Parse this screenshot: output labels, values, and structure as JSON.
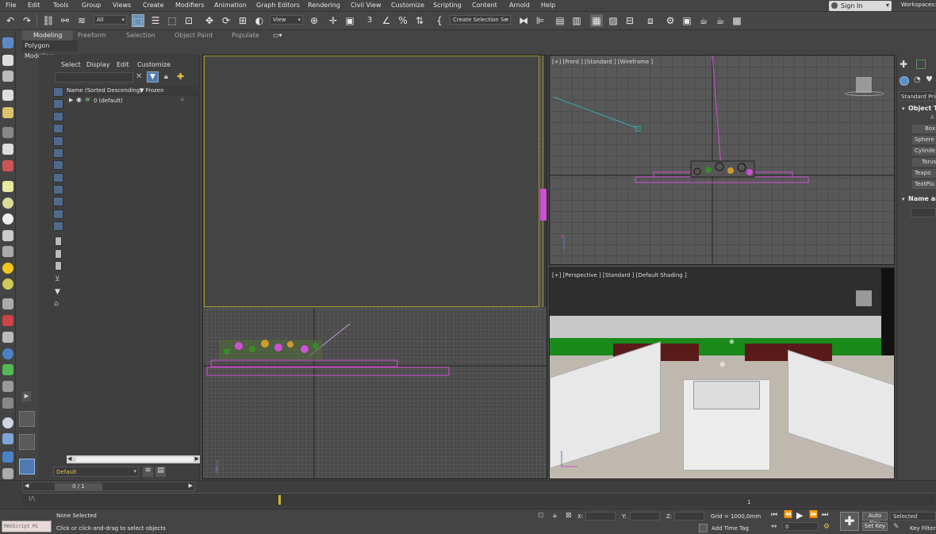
{
  "menu": [
    "File",
    "Edit",
    "Tools",
    "Group",
    "Views",
    "Create",
    "Modifiers",
    "Animation",
    "Graph Editors",
    "Rendering",
    "Civil View",
    "Customize",
    "Scripting",
    "Content",
    "Arnold",
    "Help"
  ],
  "account": {
    "sign_in": "Sign In",
    "workspaces": "Workspaces:"
  },
  "toolbar": {
    "filter_value": "All",
    "view_value": "View",
    "selection_set": "Create Selection Se"
  },
  "ribbon": {
    "tabs": [
      "Modeling",
      "Freeform",
      "Selection",
      "Object Paint",
      "Populate"
    ],
    "sub_label": "Polygon Modeling"
  },
  "explorer": {
    "menu": [
      "Select",
      "Display",
      "Edit",
      "Customize"
    ],
    "column_name": "Name (Sorted Descending)",
    "column_frozen": "▼ Frozen",
    "layer": "0 (default)",
    "layer_dropdown": "Default",
    "frame_counter": "0 / 1"
  },
  "viewports": {
    "front": "[+] [Front ] [Standard ] [Wireframe ]",
    "perspective": "[+] [Perspective ] [Standard ] [Default Shading ]"
  },
  "command_panel": {
    "category": "Standard Prim",
    "rollout_object_type": "Object Ty",
    "buttons": [
      "Box",
      "Sphere",
      "Cylinde",
      "Torus",
      "Teapo",
      "TextPlu"
    ],
    "rollout_name": "Name and"
  },
  "status": {
    "maxscript": "MAXScript Mi",
    "selection": "None Selected",
    "prompt": "Click or click-and-drag to select objects",
    "x_label": "X:",
    "y_label": "Y:",
    "z_label": "Z:",
    "grid": "Grid = 1000,0mm",
    "add_time_tag": "Add Time Tag",
    "auto_key": "Auto Key",
    "set_key": "Set Key",
    "selected": "Selected",
    "key_filters": "Key Filters",
    "frame_value": "0",
    "timeline_marker": "1"
  },
  "colors": {
    "accent": "#5a8fcb",
    "wire_magenta": "#d14fd6",
    "wire_yellow": "#a89a2c",
    "floor_green": "#1a8a1a"
  }
}
